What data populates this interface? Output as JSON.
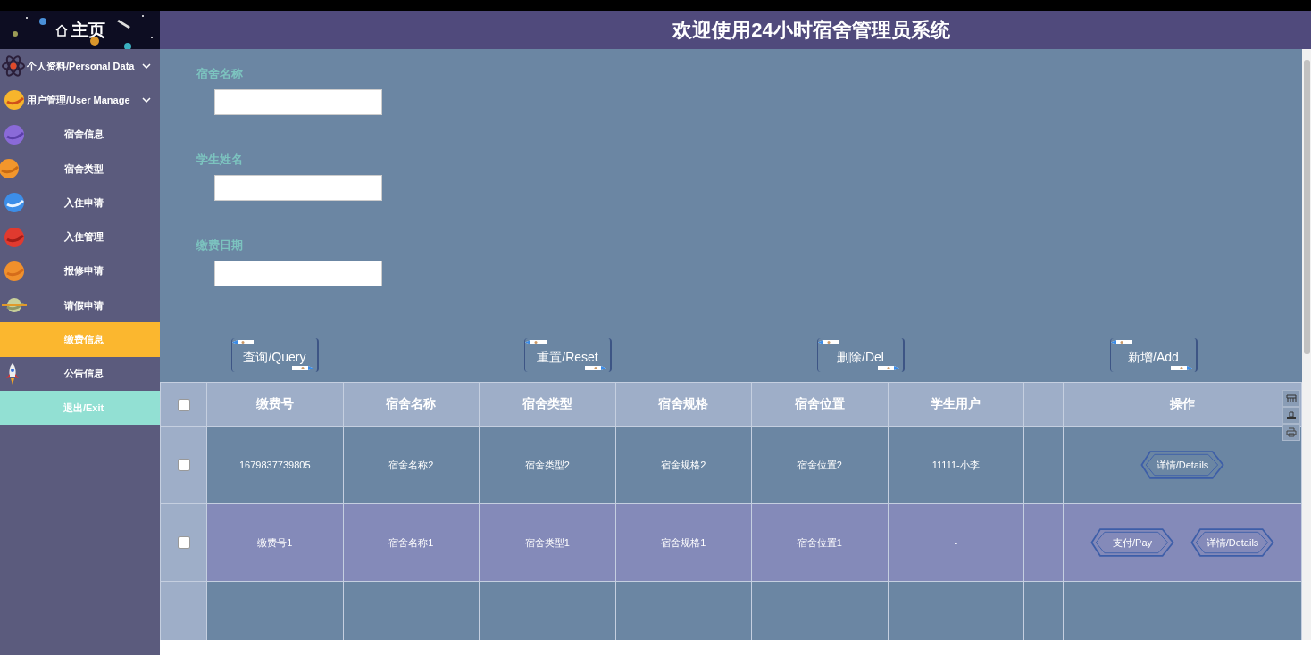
{
  "sidebar": {
    "home": {
      "label": "主页"
    },
    "items": [
      {
        "kind": "group",
        "label": "个人资料/Personal Data",
        "selected": false
      },
      {
        "kind": "group",
        "label": "用户管理/User Manage",
        "selected": false
      },
      {
        "kind": "link",
        "label": "宿舍信息",
        "selected": false
      },
      {
        "kind": "link",
        "label": "宿舍类型",
        "selected": false
      },
      {
        "kind": "link",
        "label": "入住申请",
        "selected": false
      },
      {
        "kind": "link",
        "label": "入住管理",
        "selected": false
      },
      {
        "kind": "link",
        "label": "报修申请",
        "selected": false
      },
      {
        "kind": "link",
        "label": "请假申请",
        "selected": false
      },
      {
        "kind": "link",
        "label": "缴费信息",
        "selected": true
      },
      {
        "kind": "link",
        "label": "公告信息",
        "selected": false
      },
      {
        "kind": "exit",
        "label": "退出/Exit",
        "selected": false
      }
    ]
  },
  "header": {
    "title": "欢迎使用24小时宿舍管理员系统"
  },
  "search": {
    "fields": [
      {
        "label": "宿舍名称"
      },
      {
        "label": "学生姓名"
      },
      {
        "label": "缴费日期"
      }
    ],
    "buttons": [
      "查询/Query",
      "重置/Reset",
      "删除/Del",
      "新增/Add"
    ]
  },
  "table": {
    "columns": [
      "缴费号",
      "宿舍名称",
      "宿舍类型",
      "宿舍规格",
      "宿舍位置",
      "学生用户",
      "操作"
    ],
    "header_checked": false,
    "rows": [
      {
        "checked": false,
        "cells": [
          "1679837739805",
          "宿舍名称2",
          "宿舍类型2",
          "宿舍规格2",
          "宿舍位置2",
          "11111-小李"
        ],
        "actions": [
          "详情/Details"
        ]
      },
      {
        "checked": false,
        "cells": [
          "缴费号1",
          "宿舍名称1",
          "宿舍类型1",
          "宿舍规格1",
          "宿舍位置1",
          "-"
        ],
        "actions": [
          "支付/Pay",
          "详情/Details"
        ]
      }
    ]
  }
}
